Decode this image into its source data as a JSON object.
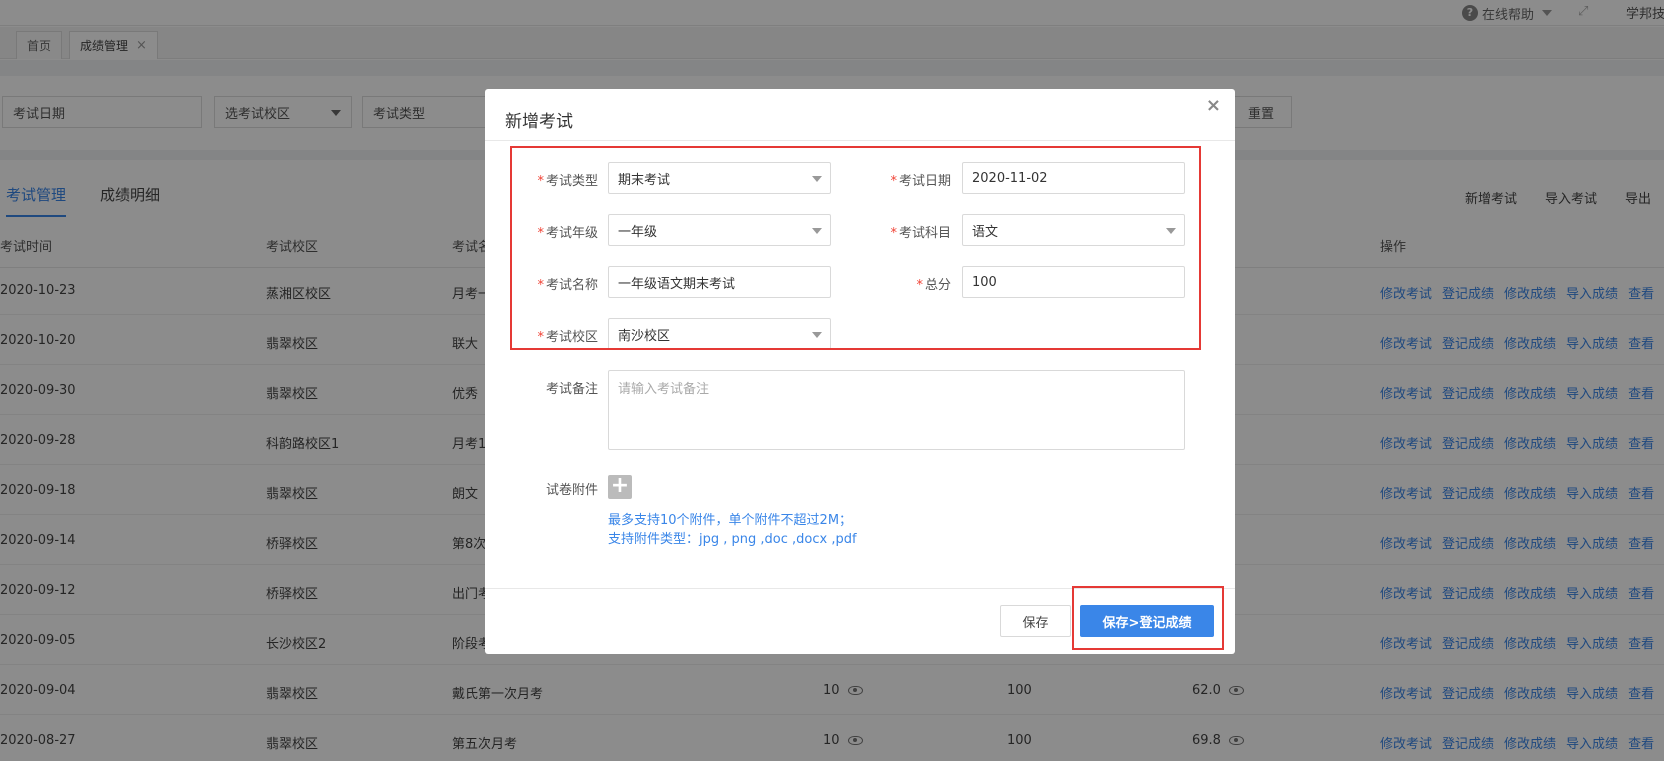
{
  "topbar": {
    "help_label": "在线帮助",
    "user_label": "学邦技"
  },
  "tabs": [
    {
      "label": "首页"
    },
    {
      "label": "成绩管理"
    }
  ],
  "filters": {
    "date_placeholder": "考试日期",
    "campus_placeholder": "选考试校区",
    "type_placeholder": "考试类型",
    "reset_label": "重置"
  },
  "list": {
    "tabs": [
      "考试管理",
      "成绩明细"
    ],
    "actions": [
      "新增考试",
      "导入考试",
      "导出"
    ],
    "headers": {
      "time": "考试时间",
      "campus": "考试校区",
      "name": "考试名",
      "ops": "操作"
    },
    "row_actions": [
      "修改考试",
      "登记成绩",
      "修改成绩",
      "导入成绩",
      "查看"
    ],
    "rows": [
      {
        "date": "2020-10-23",
        "campus": "蒸湘区校区",
        "name": "月考一",
        "count": "",
        "total": "",
        "avg": ""
      },
      {
        "date": "2020-10-20",
        "campus": "翡翠校区",
        "name": "联大",
        "count": "",
        "total": "",
        "avg": ""
      },
      {
        "date": "2020-09-30",
        "campus": "翡翠校区",
        "name": "优秀",
        "count": "",
        "total": "",
        "avg": ""
      },
      {
        "date": "2020-09-28",
        "campus": "科韵路校区1",
        "name": "月考1",
        "count": "",
        "total": "",
        "avg": ""
      },
      {
        "date": "2020-09-18",
        "campus": "翡翠校区",
        "name": "朗文",
        "count": "",
        "total": "",
        "avg": ""
      },
      {
        "date": "2020-09-14",
        "campus": "桥驿校区",
        "name": "第8次",
        "count": "",
        "total": "",
        "avg": ""
      },
      {
        "date": "2020-09-12",
        "campus": "桥驿校区",
        "name": "出门考",
        "count": "",
        "total": "",
        "avg": ""
      },
      {
        "date": "2020-09-05",
        "campus": "长沙校区2",
        "name": "阶段考",
        "count": "",
        "total": "",
        "avg": ""
      },
      {
        "date": "2020-09-04",
        "campus": "翡翠校区",
        "name": "戴氏第一次月考",
        "count": "10",
        "total": "100",
        "avg": "62.0"
      },
      {
        "date": "2020-08-27",
        "campus": "翡翠校区",
        "name": "第五次月考",
        "count": "10",
        "total": "100",
        "avg": "69.8"
      }
    ]
  },
  "modal": {
    "title": "新增考试",
    "fields": {
      "exam_type": {
        "label": "考试类型",
        "value": "期末考试"
      },
      "exam_date": {
        "label": "考试日期",
        "value": "2020-11-02"
      },
      "exam_grade": {
        "label": "考试年级",
        "value": "一年级"
      },
      "exam_subject": {
        "label": "考试科目",
        "value": "语文"
      },
      "exam_name": {
        "label": "考试名称",
        "value": "一年级语文期末考试"
      },
      "total_score": {
        "label": "总分",
        "value": "100"
      },
      "exam_campus": {
        "label": "考试校区",
        "value": "南沙校区"
      },
      "remark": {
        "label": "考试备注",
        "placeholder": "请输入考试备注"
      },
      "attachment": {
        "label": "试卷附件"
      }
    },
    "hints": [
      "最多支持10个附件，单个附件不超过2M；",
      "支持附件类型：jpg , png ,doc ,docx ,pdf"
    ],
    "buttons": {
      "save": "保存",
      "save_register": "保存>登记成绩"
    }
  }
}
